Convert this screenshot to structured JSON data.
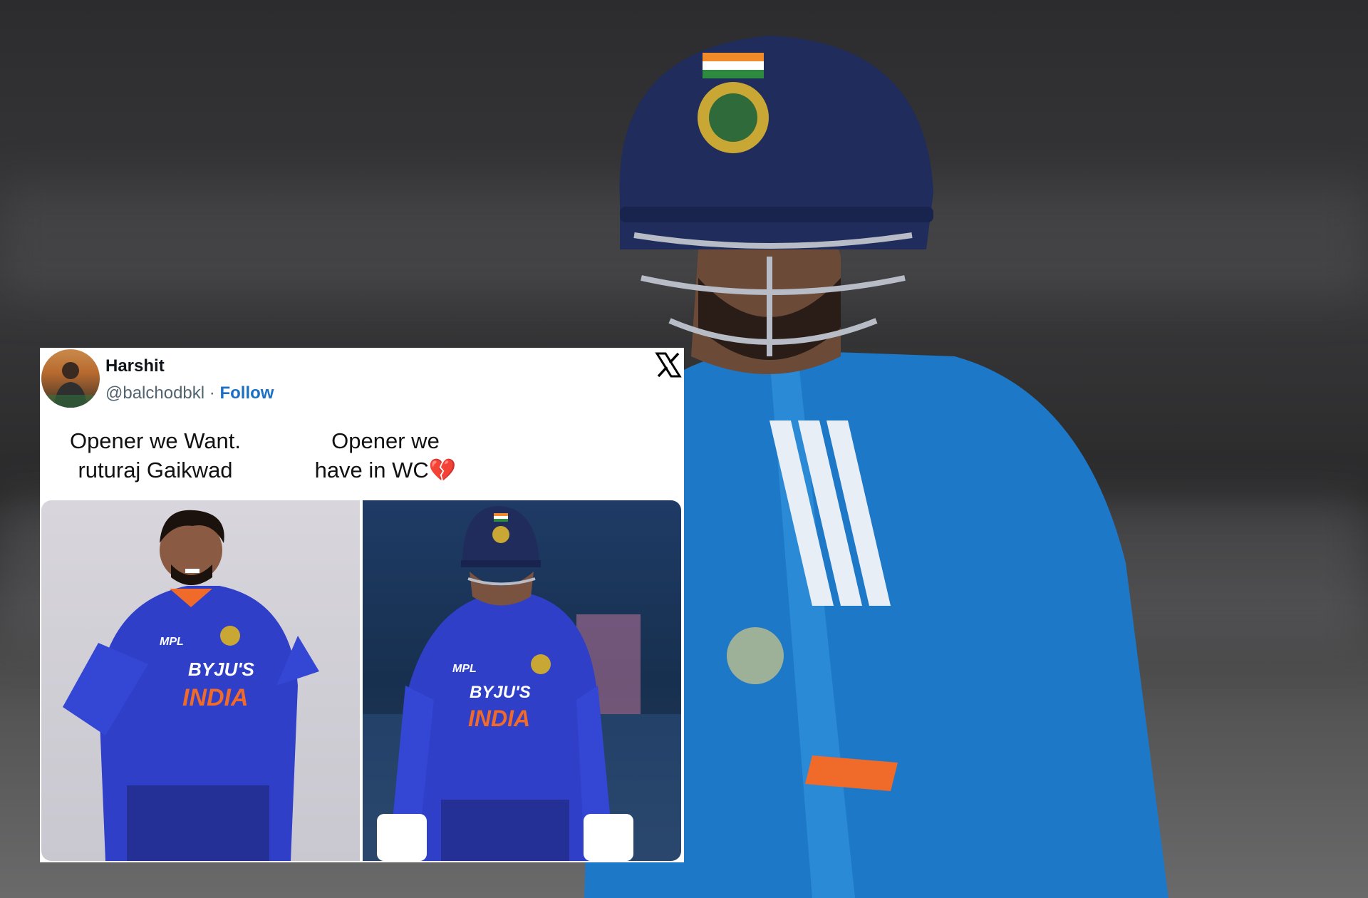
{
  "tweet": {
    "user_name": "Harshit",
    "handle": "@balchodbkl",
    "separator": "·",
    "follow_label": "Follow",
    "text_left_line1": "Opener we Want.",
    "text_left_line2": "ruturaj Gaikwad",
    "text_right_line1": "Opener we",
    "text_right_line2": "have in WC",
    "emoji": "💔",
    "brand_icon": "x-logo-icon",
    "media": [
      {
        "jersey_sponsor": "MPL",
        "jersey_brand": "BYJU'S",
        "jersey_team": "INDIA"
      },
      {
        "jersey_sponsor": "MPL",
        "jersey_brand": "BYJU'S",
        "jersey_team": "INDIA"
      }
    ]
  },
  "colors": {
    "follow": "#1d6fc4",
    "handle": "#536471",
    "name": "#0f1419",
    "jersey_blue": "#2f3fc8",
    "helmet_navy": "#1f2c5c"
  }
}
